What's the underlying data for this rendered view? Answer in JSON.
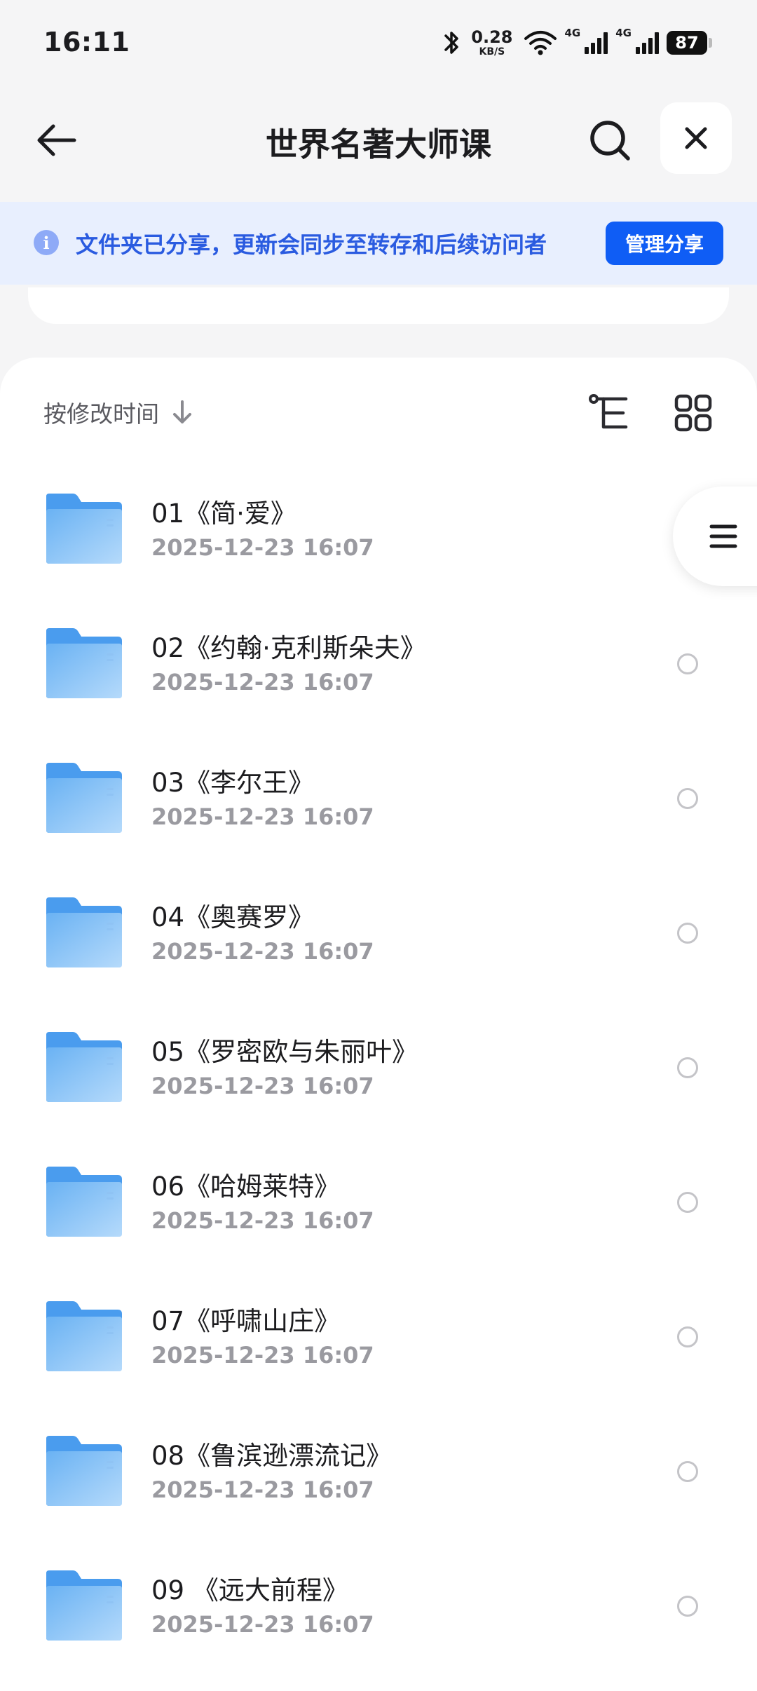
{
  "status_bar": {
    "time": "16:11",
    "net_speed": "0.28",
    "net_unit": "KB/S",
    "signal1_label": "4G",
    "signal2_label": "4G",
    "battery": "87"
  },
  "header": {
    "title": "世界名著大师课"
  },
  "share_banner": {
    "message": "文件夹已分享，更新会同步至转存和后续访问者",
    "button_label": "管理分享"
  },
  "toolbar": {
    "sort_label": "按修改时间"
  },
  "files": [
    {
      "name": "01《简·爱》",
      "date": "2025-12-23 16:07"
    },
    {
      "name": "02《约翰·克利斯朵夫》",
      "date": "2025-12-23 16:07"
    },
    {
      "name": "03《李尔王》",
      "date": "2025-12-23 16:07"
    },
    {
      "name": "04《奥赛罗》",
      "date": "2025-12-23 16:07"
    },
    {
      "name": "05《罗密欧与朱丽叶》",
      "date": "2025-12-23 16:07"
    },
    {
      "name": "06《哈姆莱特》",
      "date": "2025-12-23 16:07"
    },
    {
      "name": "07《呼啸山庄》",
      "date": "2025-12-23 16:07"
    },
    {
      "name": "08《鲁滨逊漂流记》",
      "date": "2025-12-23 16:07"
    },
    {
      "name": "09 《远大前程》",
      "date": "2025-12-23 16:07"
    }
  ],
  "colors": {
    "accent": "#0f5df5",
    "banner_bg": "#e8effe",
    "banner_text": "#2a5be0",
    "folder": "#5aa8f0"
  },
  "icons": {
    "back": "arrow-left-icon",
    "search": "search-icon",
    "close": "close-icon",
    "info": "info-icon",
    "sort": "arrow-down-icon",
    "tree": "tree-view-icon",
    "grid": "grid-view-icon",
    "folder": "folder-icon",
    "menu": "menu-icon"
  }
}
